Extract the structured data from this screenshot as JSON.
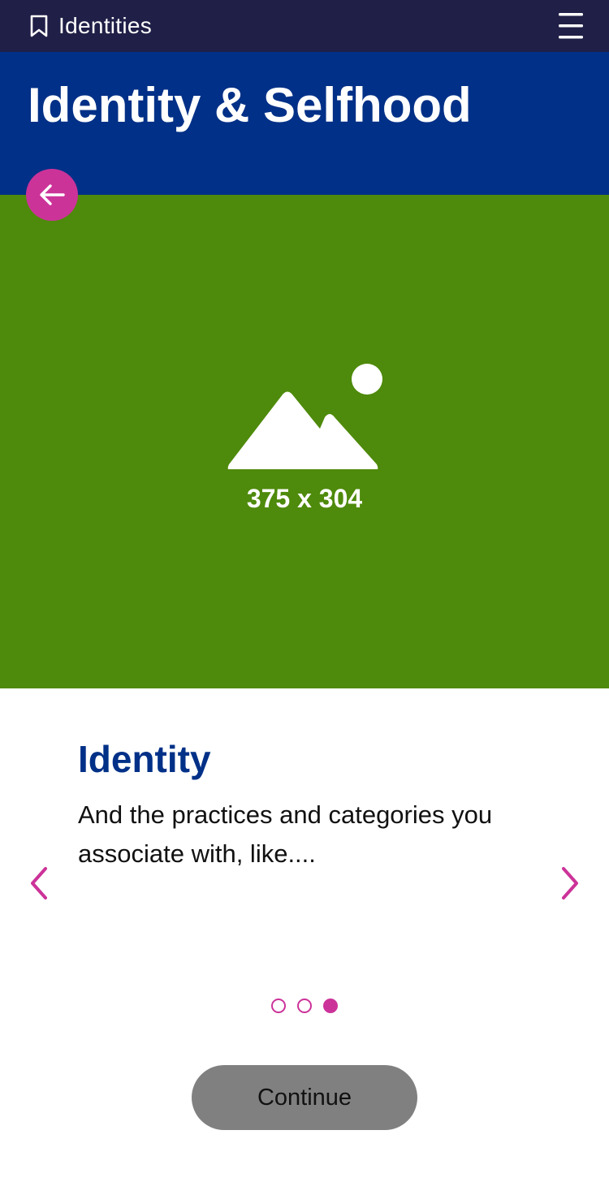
{
  "topbar": {
    "app_name": "Identities",
    "bookmark_icon": "bookmark-icon",
    "menu_icon": "hamburger-menu-icon"
  },
  "header": {
    "title": "Identity & Selfhood",
    "back_icon": "arrow-left-icon"
  },
  "hero": {
    "placeholder_icon": "image-placeholder-icon",
    "dimensions_label": "375 x 304"
  },
  "card": {
    "title": "Identity",
    "body": "And the practices and categories you associate with, like...."
  },
  "carousel": {
    "prev_icon": "chevron-left-icon",
    "next_icon": "chevron-right-icon",
    "page_count": 3,
    "active_index": 2
  },
  "footer": {
    "continue_label": "Continue"
  },
  "colors": {
    "topbar_bg": "#1f1f47",
    "header_bg": "#003087",
    "hero_bg": "#4e8a0b",
    "accent": "#cc3399",
    "title_blue": "#003087",
    "button_gray": "#808080"
  }
}
